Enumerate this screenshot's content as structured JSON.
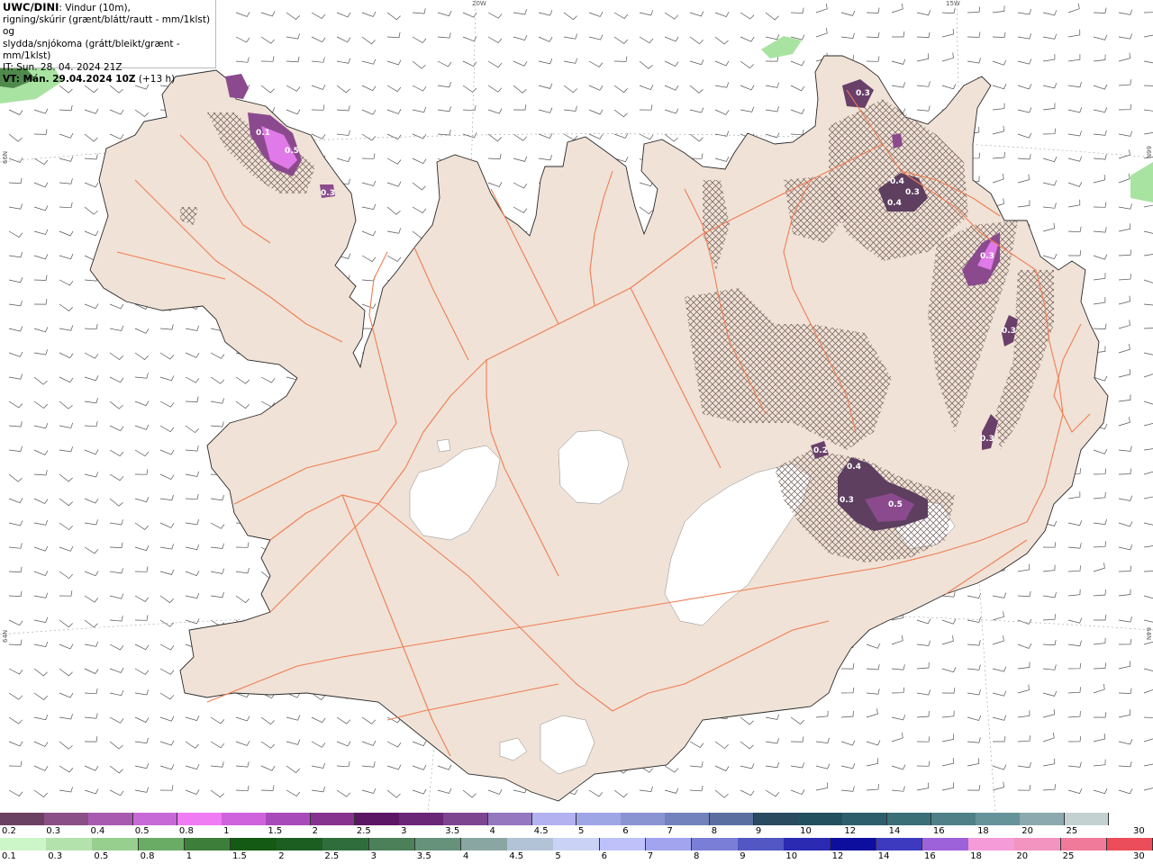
{
  "header": {
    "title": "UWC/DINI",
    "subtitle_line1": ": Vindur (10m),",
    "subtitle_line2": "rigning/skúrir (grænt/blátt/rautt - mm/1klst) og",
    "subtitle_line3": "slydda/snjókoma (grátt/bleikt/grænt - mm/1klst)",
    "issue_time": "IT: Sun. 28. 04. 2024 21Z",
    "valid_time_label": "VT: Mán. 29.04.2024 10Z",
    "valid_time_offset": " (+13 h)"
  },
  "coordinates": {
    "lon_20w": "20W",
    "lon_15w": "15W",
    "lat_66n_left": "66N",
    "lat_66n_right": "66N",
    "lat_64n_left": "64N",
    "lat_64n_right": "64N"
  },
  "map_values": [
    {
      "label": "0.3"
    },
    {
      "label": "0.1"
    },
    {
      "label": "0.5"
    },
    {
      "label": "0.4"
    },
    {
      "label": "0.3"
    },
    {
      "label": "0.4"
    },
    {
      "label": "0.3"
    },
    {
      "label": "0.3"
    },
    {
      "label": "0.2"
    },
    {
      "label": "0.4"
    },
    {
      "label": "0.3"
    },
    {
      "label": "0.5"
    },
    {
      "label": "0.3"
    },
    {
      "label": "0.3"
    }
  ],
  "legend_snow": {
    "labels": [
      "0.2",
      "0.3",
      "0.4",
      "0.5",
      "0.8",
      "1",
      "1.5",
      "2",
      "2.5",
      "3",
      "3.5",
      "4",
      "4.5",
      "5",
      "6",
      "7",
      "8",
      "9",
      "10",
      "12",
      "14",
      "16",
      "18",
      "20",
      "25",
      "30"
    ],
    "colors": [
      "#6b4163",
      "#8a4f86",
      "#a85ab0",
      "#c76ad7",
      "#f07cf3",
      "#cf62dd",
      "#a94aba",
      "#86338f",
      "#5c1464",
      "#6b2678",
      "#7d4590",
      "#9577c0",
      "#b3b1f0",
      "#9fa6e6",
      "#8a94d2",
      "#7381bc",
      "#5a6ea0",
      "#2a4a5f",
      "#23505f",
      "#2c5f6b",
      "#3a6f78",
      "#4f8088",
      "#66939a",
      "#8ba9ae",
      "#c3d1d1"
    ]
  },
  "legend_rain": {
    "labels": [
      "0.1",
      "0.3",
      "0.5",
      "0.8",
      "1",
      "1.5",
      "2",
      "2.5",
      "3",
      "3.5",
      "4",
      "4.5",
      "5",
      "6",
      "7",
      "8",
      "9",
      "10",
      "12",
      "14",
      "16",
      "18",
      "20",
      "25",
      "30"
    ],
    "colors": [
      "#ccf5c8",
      "#b4e2ad",
      "#96cf8e",
      "#6aac66",
      "#3c7e3a",
      "#145a14",
      "#1c5e22",
      "#2f6e3c",
      "#4b8058",
      "#66917a",
      "#8aa6a3",
      "#b2c3d8",
      "#cad3f5",
      "#bfc1fb",
      "#a2a4f0",
      "#7b7ed7",
      "#5357c3",
      "#2a2ab2",
      "#0e0e9e",
      "#3d3ac0",
      "#9d61d9",
      "#f59bd7",
      "#f393c0",
      "#f07a99",
      "#ec4d5a",
      "#ec1c1c"
    ]
  },
  "colors": {
    "land": "#f0e2d6",
    "road": "#f07e55",
    "ice": "#ffffff",
    "precip_dark": "#5e3f60",
    "precip_mid": "#8b4a8e",
    "precip_light": "#e07ae8",
    "rain_green": "#a9e3a2"
  }
}
